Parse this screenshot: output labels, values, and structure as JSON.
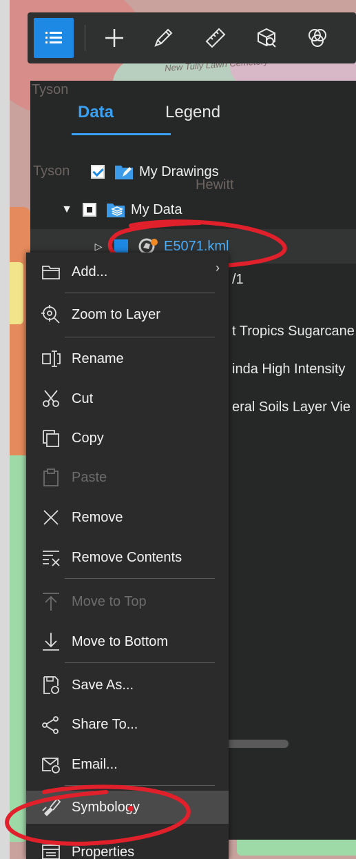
{
  "map": {
    "labels": {
      "tyson_1": "Tyson",
      "tyson_2": "Tyson",
      "hewitt": "Hewitt",
      "cemetery": "New Tully Lawn Cemetery"
    }
  },
  "toolbar": {
    "tools": [
      {
        "name": "layer-list-tool",
        "icon": "list-icon"
      },
      {
        "name": "add-data-tool",
        "icon": "plus-icon"
      },
      {
        "name": "draw-tool",
        "icon": "pencil-icon"
      },
      {
        "name": "measure-tool",
        "icon": "ruler-icon"
      },
      {
        "name": "query-tool",
        "icon": "cube-search-icon"
      },
      {
        "name": "overlay-tool",
        "icon": "overlap-circles-icon"
      }
    ]
  },
  "panel": {
    "tabs": [
      "Data",
      "Legend"
    ],
    "active_tab": "Data",
    "layers": {
      "my_drawings": "My Drawings",
      "my_data": "My Data",
      "kml": "E5071.kml",
      "kml_partial": "/1"
    },
    "background_rows": [
      "t Tropics Sugarcane",
      "inda High Intensity",
      "eral Soils Layer Vie"
    ]
  },
  "context_menu": {
    "items": [
      {
        "label": "Add...",
        "icon": "folder-icon",
        "enabled": true
      },
      {
        "label": "Zoom to Layer",
        "icon": "zoom-target-icon",
        "enabled": true
      },
      {
        "label": "Rename",
        "icon": "rename-icon",
        "enabled": true
      },
      {
        "label": "Cut",
        "icon": "scissors-icon",
        "enabled": true
      },
      {
        "label": "Copy",
        "icon": "copy-icon",
        "enabled": true
      },
      {
        "label": "Paste",
        "icon": "clipboard-icon",
        "enabled": false
      },
      {
        "label": "Remove",
        "icon": "x-icon",
        "enabled": true
      },
      {
        "label": "Remove Contents",
        "icon": "remove-contents-icon",
        "enabled": true
      },
      {
        "label": "Move to Top",
        "icon": "arrow-up-icon",
        "enabled": false
      },
      {
        "label": "Move to Bottom",
        "icon": "arrow-down-icon",
        "enabled": true
      },
      {
        "label": "Save As...",
        "icon": "save-as-icon",
        "enabled": true
      },
      {
        "label": "Share To...",
        "icon": "share-icon",
        "enabled": true
      },
      {
        "label": "Email...",
        "icon": "email-icon",
        "enabled": true
      },
      {
        "label": "Symbology",
        "icon": "paint-icon",
        "enabled": true,
        "highlighted": true
      },
      {
        "label": "Properties",
        "icon": "properties-icon",
        "enabled": true
      }
    ]
  },
  "colors": {
    "accent": "#1e88e5",
    "active_tab": "#3aa0f3",
    "panel_bg": "#262727",
    "menu_bg": "#2b2b2b",
    "annotation": "#e0202a"
  }
}
